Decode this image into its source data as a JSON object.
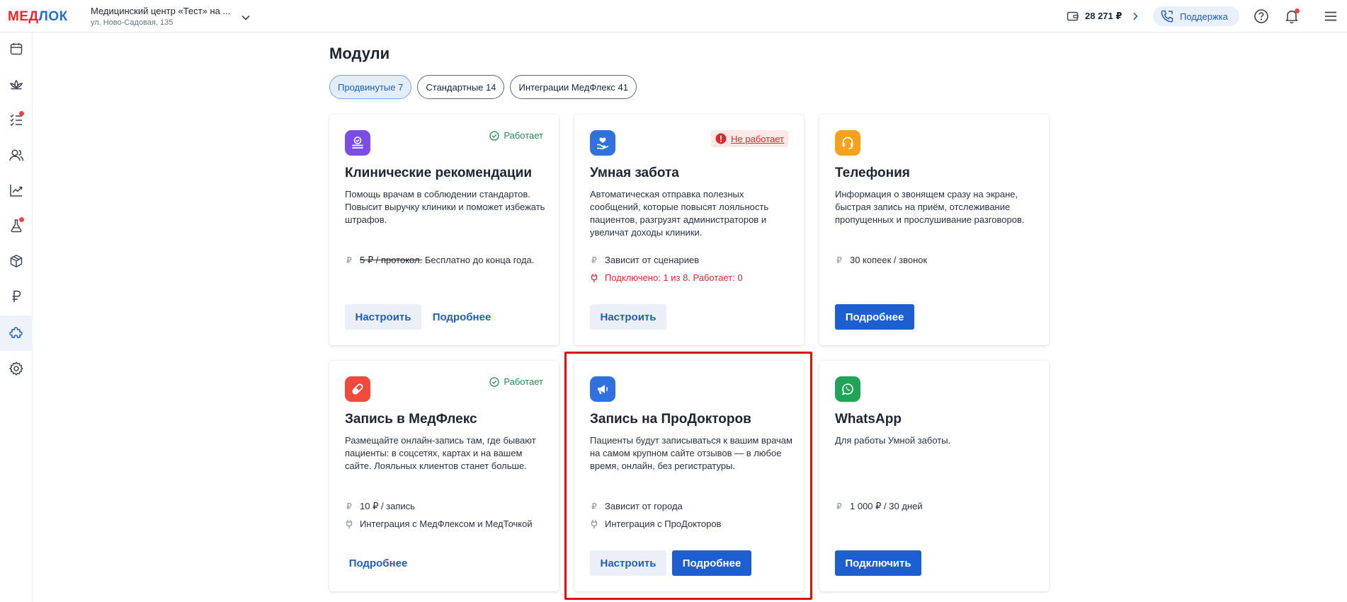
{
  "topbar": {
    "logo_part1": "МЕД",
    "logo_part2": "ЛОК",
    "clinic_name": "Медицинский центр «Тест» на ...",
    "clinic_address": "ул. Ново-Садовая, 135",
    "balance": "28 271 ₽",
    "support_label": "Поддержка"
  },
  "page": {
    "title": "Модули",
    "tabs": [
      {
        "label": "Продвинутые 7",
        "active": true
      },
      {
        "label": "Стандартные 14",
        "active": false
      },
      {
        "label": "Интеграции МедФлекс 41",
        "active": false
      }
    ]
  },
  "cards": [
    {
      "title": "Клинические рекомендации",
      "status": "Работает",
      "description": "Помощь врачам в соблюдении стандартов. Повысит выручку клиники и поможет избежать штрафов.",
      "price_strike": "5 ₽ / протокол.",
      "price": "Бесплатно до конца года.",
      "btn_configure": "Настроить",
      "btn_more": "Подробнее",
      "icon_color": "#7b4de3"
    },
    {
      "title": "Умная забота",
      "status": "Не работает",
      "description": "Автоматическая отправка полезных сообщений, которые повысят лояльность пациентов, разгрузят администраторов и увеличат доходы клиники.",
      "price": "Зависит от сценариев",
      "connection": "Подключено: 1 из 8. Работает: 0",
      "btn_configure": "Настроить",
      "icon_color": "#2f72df"
    },
    {
      "title": "Телефония",
      "description": "Информация о звонящем сразу на экране, быстрая запись на приём, отслеживание пропущенных и прослушивание разговоров.",
      "price": "30 копеек / звонок",
      "btn_more": "Подробнее",
      "icon_color": "#f5a11c"
    },
    {
      "title": "Запись в МедФлекс",
      "status": "Работает",
      "description": "Размещайте онлайн-запись там, где бывают пациенты: в соцсетях, картах и на вашем сайте. Лояльных клиентов станет больше.",
      "price": "10 ₽ / запись",
      "integration": "Интеграция с МедФлексом и МедТочкой",
      "btn_more": "Подробнее",
      "icon_color": "#ef4a3c"
    },
    {
      "title": "Запись на ПроДокторов",
      "description": "Пациенты будут записываться к вашим врачам на самом крупном сайте отзывов — в любое время, онлайн, без регистратуры.",
      "price": "Зависит от города",
      "integration": "Интеграция с ПроДокторов",
      "btn_configure": "Настроить",
      "btn_more": "Подробнее",
      "icon_color": "#2f72df"
    },
    {
      "title": "WhatsApp",
      "description": "Для работы Умной заботы.",
      "price": "1 000 ₽ / 30 дней",
      "btn_connect": "Подключить",
      "icon_color": "#22a35a"
    }
  ],
  "colors": {
    "primary": "#1d5fd0",
    "ok": "#27894f",
    "error": "#d9292c",
    "highlight": "#e10e0e"
  },
  "sidebar_icons": [
    "calendar-icon",
    "lotus-icon",
    "checklist-icon",
    "users-icon",
    "chart-icon",
    "flask-icon",
    "box-icon",
    "ruble-icon",
    "puzzle-icon",
    "settings-icon"
  ]
}
